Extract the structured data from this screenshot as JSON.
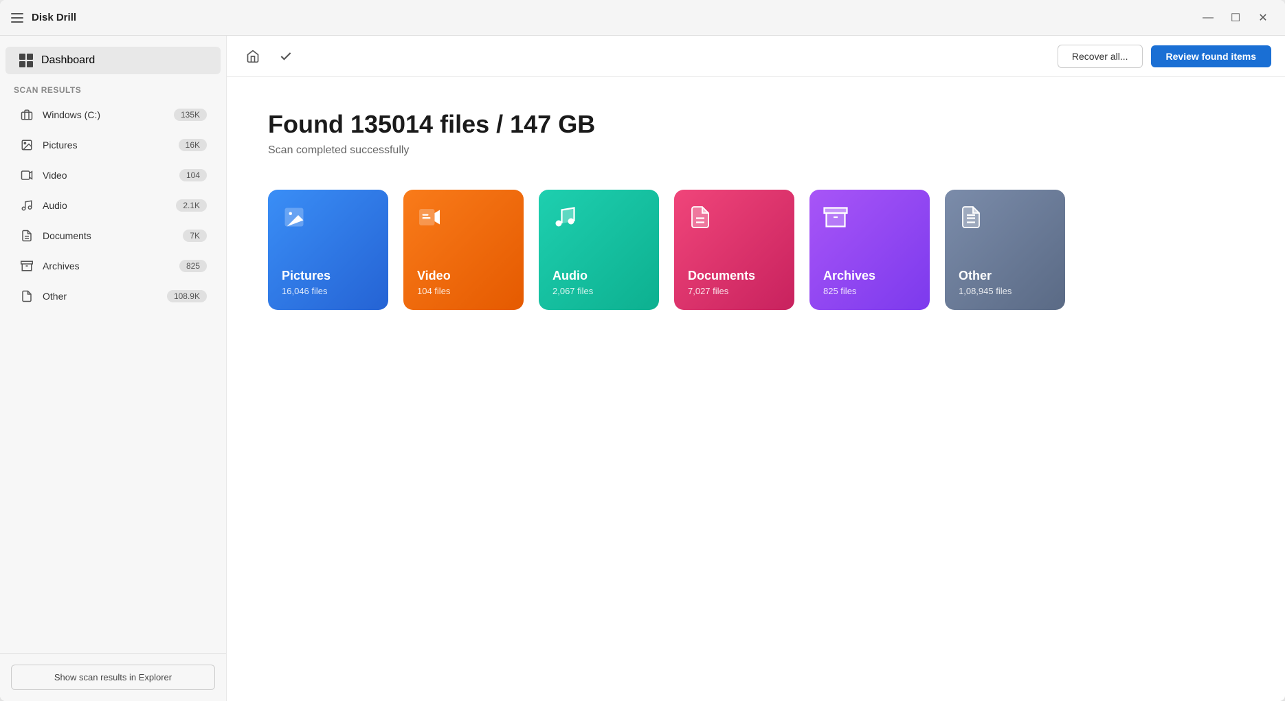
{
  "app": {
    "title": "Disk Drill"
  },
  "titlebar": {
    "minimize_label": "—",
    "maximize_label": "☐",
    "close_label": "✕"
  },
  "toolbar": {
    "recover_all_label": "Recover all...",
    "review_label": "Review found items"
  },
  "sidebar": {
    "dashboard_label": "Dashboard",
    "scan_results_label": "Scan results",
    "items": [
      {
        "id": "windows",
        "label": "Windows (C:)",
        "count": "135K",
        "icon": "hdd"
      },
      {
        "id": "pictures",
        "label": "Pictures",
        "count": "16K",
        "icon": "image"
      },
      {
        "id": "video",
        "label": "Video",
        "count": "104",
        "icon": "video"
      },
      {
        "id": "audio",
        "label": "Audio",
        "count": "2.1K",
        "icon": "music"
      },
      {
        "id": "documents",
        "label": "Documents",
        "count": "7K",
        "icon": "doc"
      },
      {
        "id": "archives",
        "label": "Archives",
        "count": "825",
        "icon": "archive"
      },
      {
        "id": "other",
        "label": "Other",
        "count": "108.9K",
        "icon": "other"
      }
    ],
    "footer_button": "Show scan results in Explorer"
  },
  "main": {
    "found_title": "Found 135014 files / 147 GB",
    "scan_status": "Scan completed successfully",
    "cards": [
      {
        "id": "pictures",
        "label": "Pictures",
        "count": "16,046 files",
        "color": "pictures"
      },
      {
        "id": "video",
        "label": "Video",
        "count": "104 files",
        "color": "video"
      },
      {
        "id": "audio",
        "label": "Audio",
        "count": "2,067 files",
        "color": "audio"
      },
      {
        "id": "documents",
        "label": "Documents",
        "count": "7,027 files",
        "color": "documents"
      },
      {
        "id": "archives",
        "label": "Archives",
        "count": "825 files",
        "color": "archives"
      },
      {
        "id": "other",
        "label": "Other",
        "count": "1,08,945 files",
        "color": "other"
      }
    ]
  }
}
